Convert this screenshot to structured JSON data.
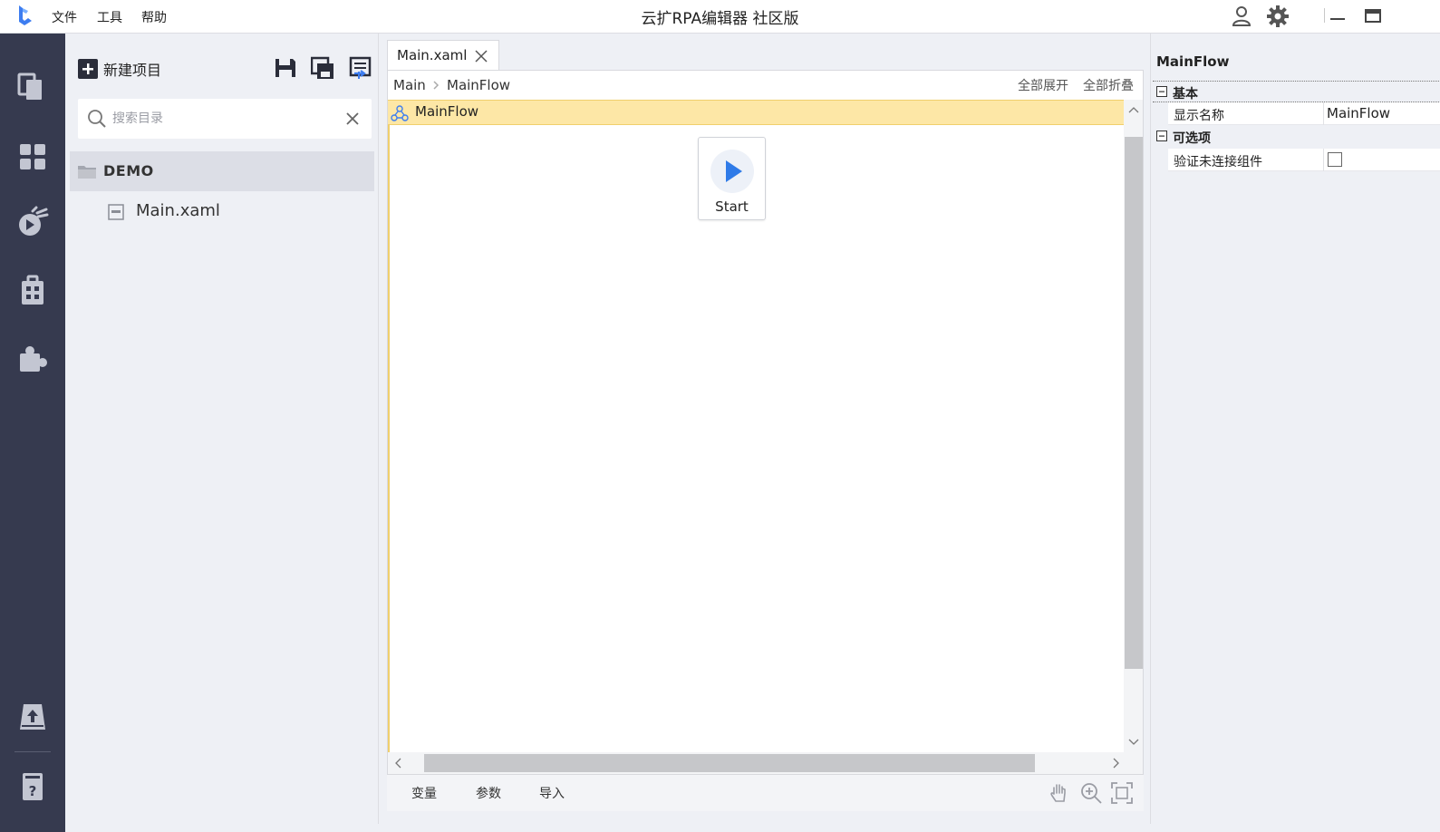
{
  "titlebar": {
    "title": "云扩RPA编辑器 社区版",
    "menu": {
      "file": "文件",
      "tools": "工具",
      "help": "帮助"
    },
    "icons": [
      "user-icon",
      "gear-icon",
      "minimize-icon",
      "maximize-icon"
    ]
  },
  "rail": {
    "icons": [
      "projects-icon",
      "components-icon",
      "run-icon",
      "library-icon",
      "plugins-icon",
      "publish-icon",
      "help-icon"
    ],
    "colors": {
      "background": "#363a4f",
      "icon": "#c3c6d2"
    }
  },
  "project": {
    "new_project": "新建项目",
    "search_placeholder": "搜索目录",
    "root_label": "DEMO",
    "file_label": "Main.xaml"
  },
  "editor": {
    "tab_label": "Main.xaml",
    "breadcrumb": {
      "root": "Main",
      "current": "MainFlow"
    },
    "expand_all": "全部展开",
    "collapse_all": "全部折叠",
    "flow_title": "MainFlow",
    "start_label": "Start",
    "bottom_tabs": {
      "variables": "变量",
      "arguments": "参数",
      "imports": "导入"
    },
    "colors": {
      "flow_header": "#fde7a6",
      "start_accent": "#2f7be8"
    }
  },
  "properties": {
    "title": "MainFlow",
    "category_basic": "基本",
    "display_name_label": "显示名称",
    "display_name_value": "MainFlow",
    "category_optional": "可选项",
    "verify_label": "验证未连接组件",
    "verify_checked": false
  }
}
